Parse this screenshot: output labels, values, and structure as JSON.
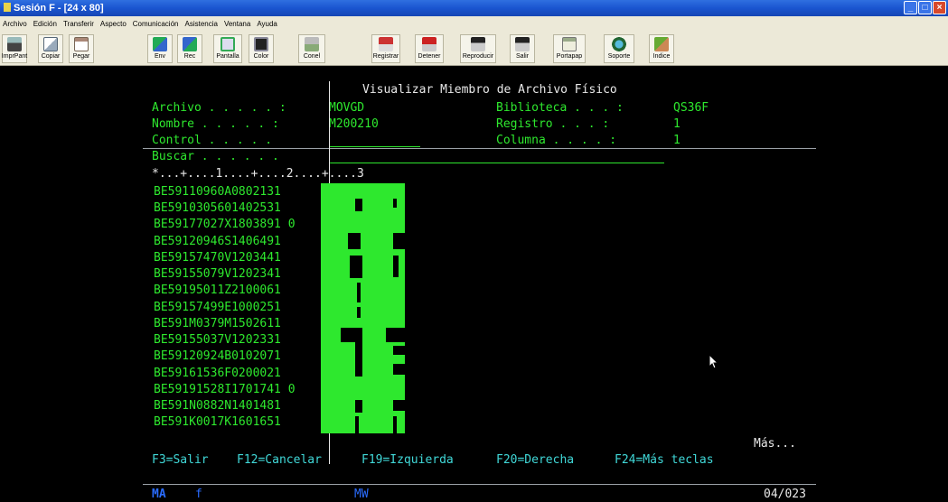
{
  "window": {
    "title": "Sesión F - [24 x 80]"
  },
  "menu": [
    "Archivo",
    "Edición",
    "Transferir",
    "Aspecto",
    "Comunicación",
    "Asistencia",
    "Ventana",
    "Ayuda"
  ],
  "toolbar": [
    {
      "label": "ImprPant",
      "icon": "print-screen-icon"
    },
    {
      "label": "Copiar",
      "icon": "copy-icon"
    },
    {
      "label": "Pegar",
      "icon": "paste-icon"
    },
    {
      "label": "Env",
      "icon": "send-icon"
    },
    {
      "label": "Rec",
      "icon": "receive-icon"
    },
    {
      "label": "Pantalla",
      "icon": "screen-icon"
    },
    {
      "label": "Color",
      "icon": "color-icon"
    },
    {
      "label": "Conel",
      "icon": "connect-icon"
    },
    {
      "label": "Registrar",
      "icon": "record-icon"
    },
    {
      "label": "Detener",
      "icon": "stop-icon"
    },
    {
      "label": "Reproducir",
      "icon": "play-icon"
    },
    {
      "label": "Salir",
      "icon": "exit-icon"
    },
    {
      "label": "Portapap",
      "icon": "clipboard-icon"
    },
    {
      "label": "Soporte",
      "icon": "support-icon"
    },
    {
      "label": "Indice",
      "icon": "index-icon"
    }
  ],
  "screen": {
    "heading": "Visualizar Miembro de Archivo Físico",
    "fields": {
      "archivo_label": "Archivo . . . . . :",
      "archivo_value": "MOVGD",
      "biblioteca_label": "Biblioteca . . . :",
      "biblioteca_value": "QS36F",
      "nombre_label": "Nombre . . . . . :",
      "nombre_value": "M200210",
      "registro_label": "Registro . . . :",
      "registro_value": "1",
      "control_label": "Control . . . . .",
      "control_value": "",
      "columna_label": "Columna . . . . :",
      "columna_value": "1",
      "buscar_label": "Buscar . . . . . .",
      "buscar_value": ""
    },
    "ruler": "*...+....1....+....2....+....3",
    "records": [
      "BE59110960A0802131",
      "BE5910305601402531",
      "BE59177027X1803891 0",
      "BE59120946S1406491",
      "BE59157470V1203441",
      "BE59155079V1202341",
      "BE59195011Z2100061",
      "BE59157499E1000251",
      "BE591M0379M1502611",
      "BE59155037V1202331",
      "BE59120924B0102071",
      "BE59161536F0200021",
      "BE59191528I1701741 0",
      "BE591N0882N1401481",
      "BE591K0017K1601651"
    ],
    "mas": "Más...",
    "fkeys": [
      "F3=Salir",
      "F12=Cancelar",
      "F19=Izquierda",
      "F20=Derecha",
      "F24=Más teclas"
    ],
    "status": {
      "left": "MA",
      "left2": "f",
      "mid": "MW",
      "right": "04/023"
    }
  }
}
